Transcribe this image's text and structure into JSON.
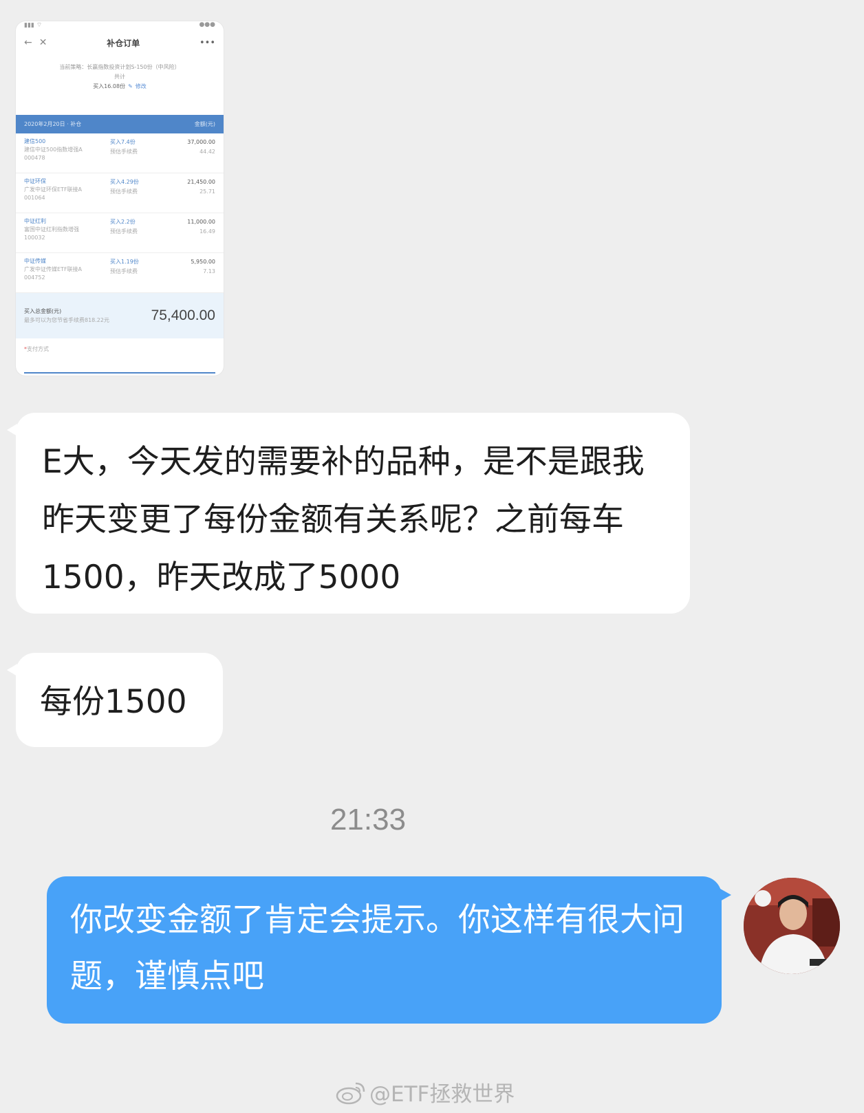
{
  "screenshot": {
    "nav_title": "补仓订单",
    "plan_label": "当前策略：长赢指数投资计划S-150份（中风险）",
    "plan_sub": "共计",
    "buy_count": "买入16.08份",
    "edit_label": "修改",
    "date_bar": "2020年2月20日 · 补仓",
    "amount_header": "金额(元)",
    "orders": [
      {
        "name": "建信500",
        "fund": "建信中证500指数增强A",
        "code": "000478",
        "buy": "买入7.4份",
        "fee_label": "预估手续费",
        "amount": "37,000.00",
        "fee": "44.42"
      },
      {
        "name": "中证环保",
        "fund": "广发中证环保ETF联接A",
        "code": "001064",
        "buy": "买入4.29份",
        "fee_label": "预估手续费",
        "amount": "21,450.00",
        "fee": "25.71"
      },
      {
        "name": "中证红利",
        "fund": "富国中证红利指数增强",
        "code": "100032",
        "buy": "买入2.2份",
        "fee_label": "预估手续费",
        "amount": "11,000.00",
        "fee": "16.49"
      },
      {
        "name": "中证传媒",
        "fund": "广发中证传媒ETF联接A",
        "code": "004752",
        "buy": "买入1.19份",
        "fee_label": "预估手续费",
        "amount": "5,950.00",
        "fee": "7.13"
      }
    ],
    "total_label": "买入总金额(元)",
    "total_sub": "最多可以为您节省手续费818.22元",
    "total_amount": "75,400.00",
    "pay_label": "支付方式"
  },
  "messages": [
    {
      "side": "left",
      "text": "E大，今天发的需要补的品种，是不是跟我昨天变更了每份金额有关系呢？之前每车1500，昨天改成了5000"
    },
    {
      "side": "left",
      "text": "每份1500"
    },
    {
      "side": "right",
      "text": "你改变金额了肯定会提示。你这样有很大问题，谨慎点吧"
    }
  ],
  "timestamp": "21:33",
  "watermark": "@ETF拯救世界",
  "colors": {
    "background": "#eeeeee",
    "sent_bubble": "#48a2f8",
    "received_bubble": "#ffffff",
    "accent": "#4f86c9"
  }
}
